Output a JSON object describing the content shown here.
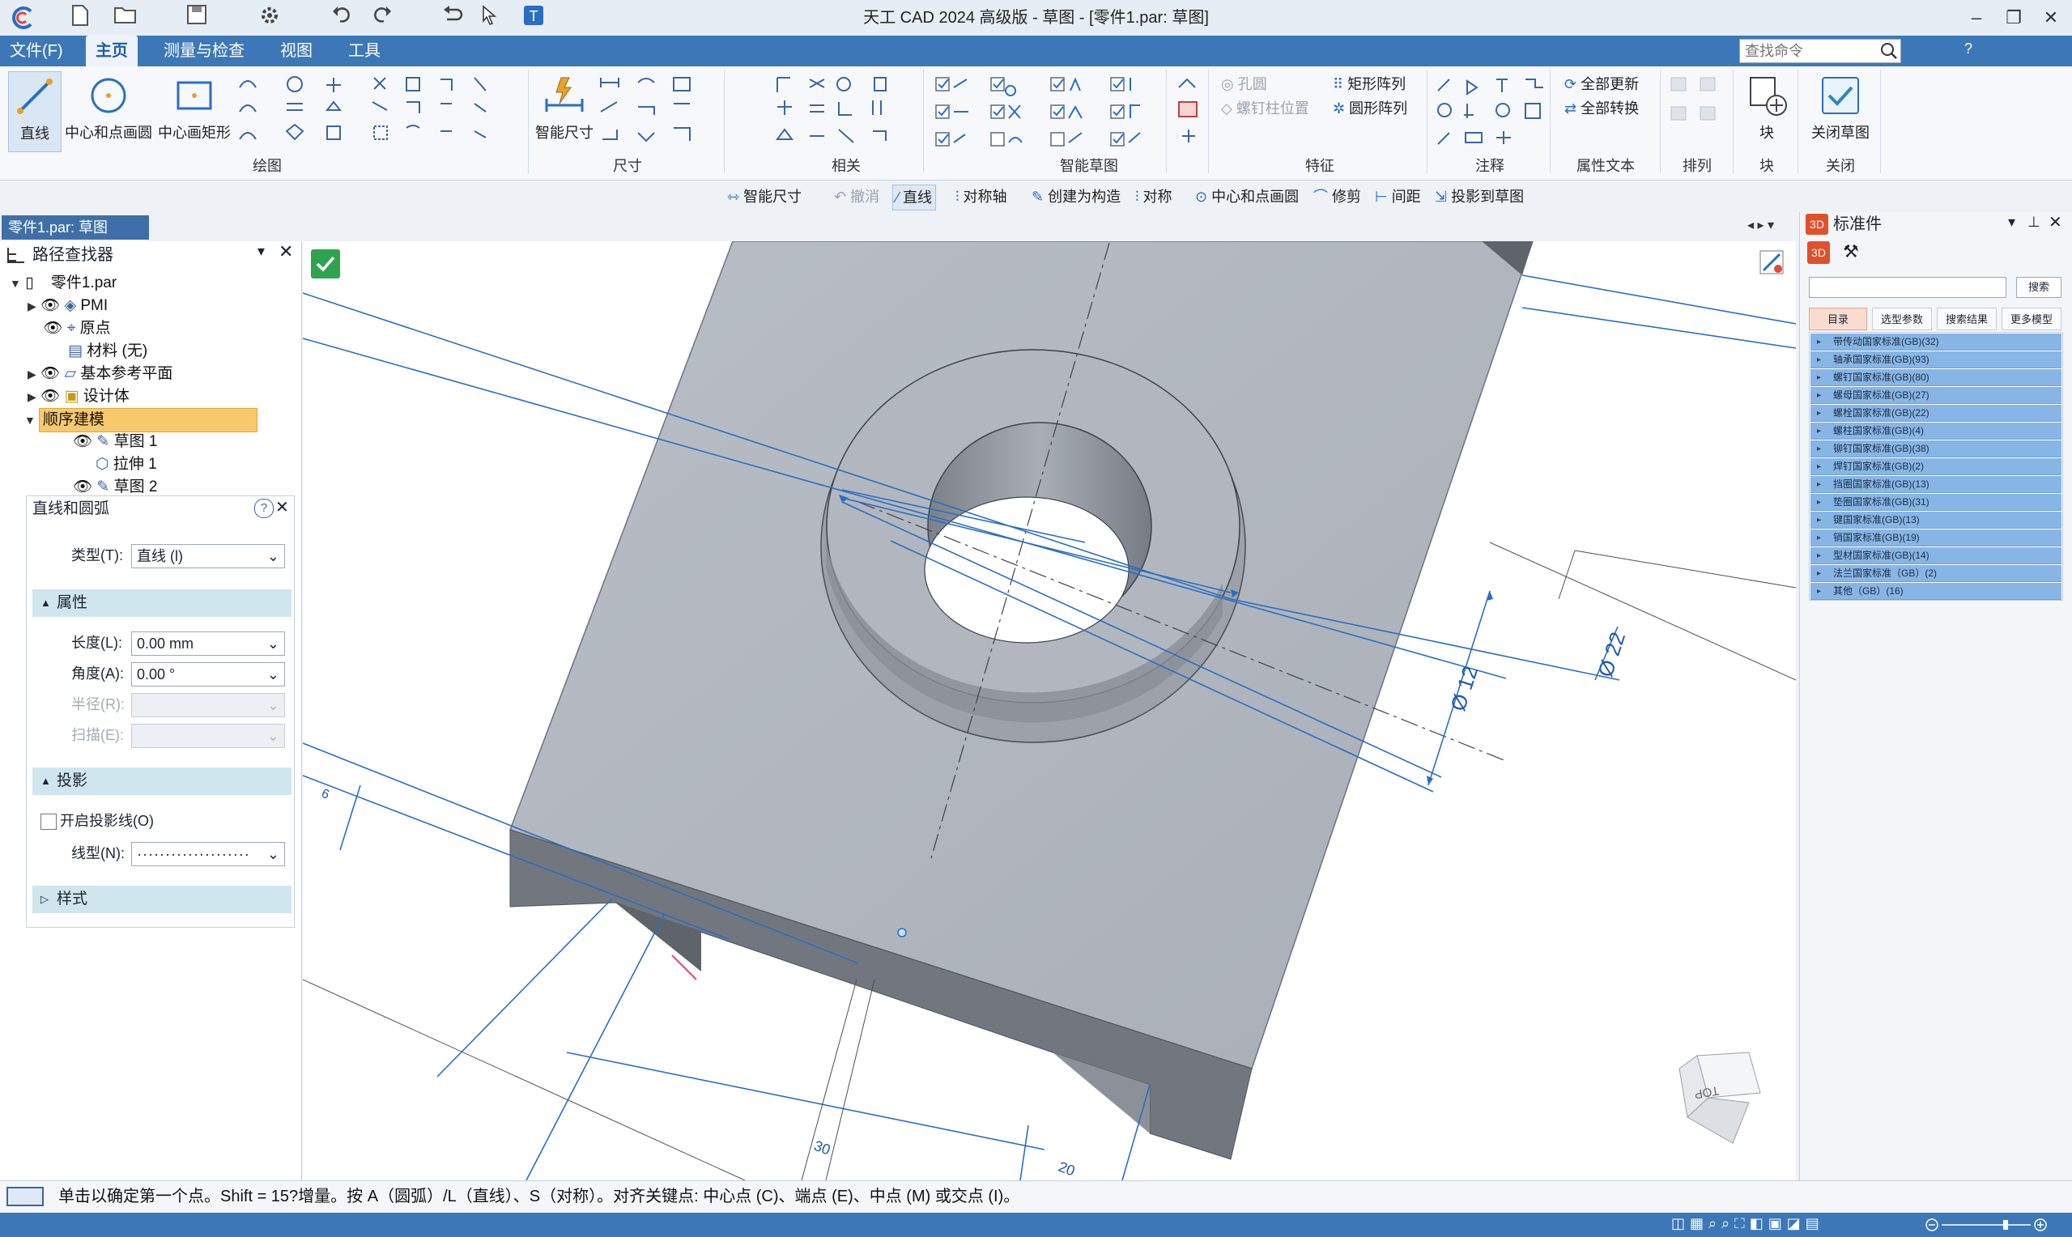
{
  "app": {
    "title": "天工 CAD 2024 高级版 - 草图 - [零件1.par: 草图]"
  },
  "menu": {
    "tabs": [
      {
        "label": "文件(F)"
      },
      {
        "label": "主页"
      },
      {
        "label": "测量与检查"
      },
      {
        "label": "视图"
      },
      {
        "label": "工具"
      }
    ],
    "search_placeholder": "查找命令"
  },
  "ribbon": {
    "draw": {
      "line": "直线",
      "center_circle": "中心和点画圆",
      "center_rect": "中心画矩形",
      "group": "绘图"
    },
    "dimension": {
      "smart": "智能尺寸",
      "group": "尺寸"
    },
    "relate": {
      "group": "相关"
    },
    "smart_sketch": {
      "group": "智能草图"
    },
    "feature": {
      "hole": "孔圆",
      "stud": "螺钉柱位置",
      "rect_array": "矩形阵列",
      "circ_array": "圆形阵列",
      "group": "特征"
    },
    "annotation": {
      "group": "注释"
    },
    "attr_text": {
      "update_all": "全部更新",
      "convert_all": "全部转换",
      "group": "属性文本"
    },
    "arrange": {
      "group": "排列"
    },
    "block": {
      "label": "块",
      "group": "块"
    },
    "close": {
      "label": "关闭草图",
      "group": "关闭"
    }
  },
  "command_bar": {
    "items": [
      {
        "label": "智能尺寸"
      },
      {
        "label": "撤消"
      },
      {
        "label": "直线"
      },
      {
        "label": "对称轴"
      },
      {
        "label": "创建为构造"
      },
      {
        "label": "对称"
      },
      {
        "label": "中心和点画圆"
      },
      {
        "label": "修剪"
      },
      {
        "label": "间距"
      },
      {
        "label": "投影到草图"
      }
    ]
  },
  "document_tab": "零件1.par: 草图",
  "pathfinder": {
    "title": "路径查找器",
    "items": [
      {
        "label": "零件1.par"
      },
      {
        "label": "PMI"
      },
      {
        "label": "原点"
      },
      {
        "label": "材料 (无)"
      },
      {
        "label": "基本参考平面"
      },
      {
        "label": "设计体"
      },
      {
        "label": "顺序建模"
      },
      {
        "label": "草图 1"
      },
      {
        "label": "拉伸 1"
      },
      {
        "label": "草图 2"
      }
    ]
  },
  "props": {
    "title": "直线和圆弧",
    "type_label": "类型(T):",
    "type_value": "直线 (l)",
    "section_attr": "属性",
    "length_label": "长度(L):",
    "length_value": "0.00 mm",
    "angle_label": "角度(A):",
    "angle_value": "0.00 °",
    "radius_label": "半径(R):",
    "sweep_label": "扫描(E):",
    "section_proj": "投影",
    "proj_checkbox": "开启投影线(O)",
    "linetype_label": "线型(N):",
    "section_style": "样式"
  },
  "viewport": {
    "dims": {
      "d12": "Ø 12",
      "d22": "Ø 22",
      "d6": "6",
      "d30": "30",
      "d20": "20"
    },
    "cube_label": "TOP"
  },
  "std_parts": {
    "title": "标准件",
    "search_btn": "搜索",
    "tabs": [
      {
        "label": "目录"
      },
      {
        "label": "选型参数"
      },
      {
        "label": "搜索结果"
      },
      {
        "label": "更多模型"
      }
    ],
    "categories": [
      {
        "label": "带传动国家标准(GB)(32)"
      },
      {
        "label": "轴承国家标准(GB)(93)"
      },
      {
        "label": "螺钉国家标准(GB)(80)"
      },
      {
        "label": "螺母国家标准(GB)(27)"
      },
      {
        "label": "螺栓国家标准(GB)(22)"
      },
      {
        "label": "螺柱国家标准(GB)(4)"
      },
      {
        "label": "铆钉国家标准(GB)(38)"
      },
      {
        "label": "焊钉国家标准(GB)(2)"
      },
      {
        "label": "挡圈国家标准(GB)(13)"
      },
      {
        "label": "垫圈国家标准(GB)(31)"
      },
      {
        "label": "键国家标准(GB)(13)"
      },
      {
        "label": "销国家标准(GB)(19)"
      },
      {
        "label": "型材国家标准(GB)(14)"
      },
      {
        "label": "法兰国家标准（GB）(2)"
      },
      {
        "label": "其他（GB）(16)"
      }
    ]
  },
  "status": {
    "text": "单击以确定第一个点。Shift = 15?增量。按 A（圆弧）/L（直线）、S（对称）。对齐关键点: 中心点 (C)、端点 (E)、中点 (M) 或交点 (I)。"
  }
}
